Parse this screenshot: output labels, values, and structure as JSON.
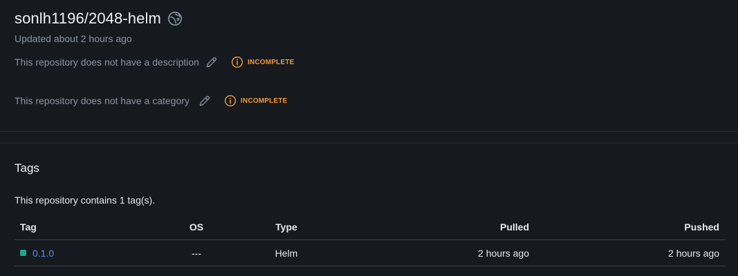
{
  "repo": {
    "title": "sonlh1196/2048-helm",
    "updated": "Updated about 2 hours ago"
  },
  "description": {
    "text": "This repository does not have a description",
    "badge": "INCOMPLETE"
  },
  "category": {
    "text": "This repository does not have a category",
    "badge": "INCOMPLETE"
  },
  "tags": {
    "section_title": "Tags",
    "count_text": "This repository contains 1 tag(s).",
    "columns": [
      "Tag",
      "OS",
      "Type",
      "Pulled",
      "Pushed"
    ],
    "rows": [
      {
        "tag": "0.1.0",
        "os": "---",
        "type": "Helm",
        "pulled": "2 hours ago",
        "pushed": "2 hours ago"
      }
    ]
  },
  "colors": {
    "background": "#16191e",
    "badge_warning": "#f09a3c",
    "status_dot": "#1fa886",
    "link": "#5b8ff0"
  },
  "icons": {
    "visibility": "globe-public-icon",
    "edit": "pencil-icon",
    "badge": "info-circle-icon"
  }
}
